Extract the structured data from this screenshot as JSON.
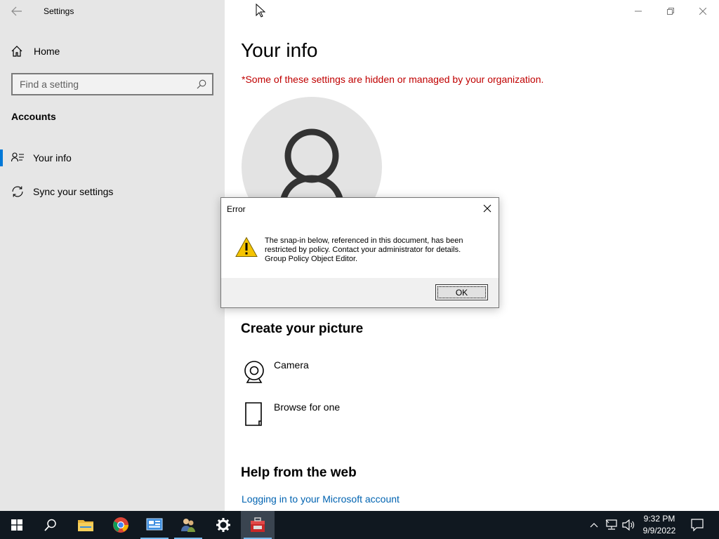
{
  "window": {
    "title": "Settings"
  },
  "sidebar": {
    "home_label": "Home",
    "search_placeholder": "Find a setting",
    "section": "Accounts",
    "items": [
      {
        "label": "Your info",
        "icon": "person-list-icon",
        "active": true
      },
      {
        "label": "Sync your settings",
        "icon": "sync-icon",
        "active": false
      }
    ]
  },
  "main": {
    "title": "Your info",
    "org_note": "*Some of these settings are hidden or managed by your organization.",
    "create_heading": "Create your picture",
    "options": [
      {
        "label": "Camera",
        "icon": "camera-icon"
      },
      {
        "label": "Browse for one",
        "icon": "file-icon"
      }
    ],
    "help_heading": "Help from the web",
    "help_link": "Logging in to your Microsoft account"
  },
  "dialog": {
    "title": "Error",
    "message_lines": [
      "The snap-in below, referenced in this document, has been",
      "restricted by policy. Contact your administrator for details.",
      "Group Policy Object Editor."
    ],
    "ok_label": "OK",
    "icon": "warning-icon"
  },
  "taskbar": {
    "apps": [
      "start-icon",
      "search-icon",
      "file-explorer-icon",
      "chrome-icon",
      "control-panel-icon",
      "users-icon",
      "settings-icon",
      "toolbox-icon"
    ],
    "time": "9:32 PM",
    "date": "9/9/2022"
  },
  "colors": {
    "accent": "#0078d7",
    "warning_text": "#c00000",
    "link": "#0063b1",
    "taskbar": "#101820"
  }
}
